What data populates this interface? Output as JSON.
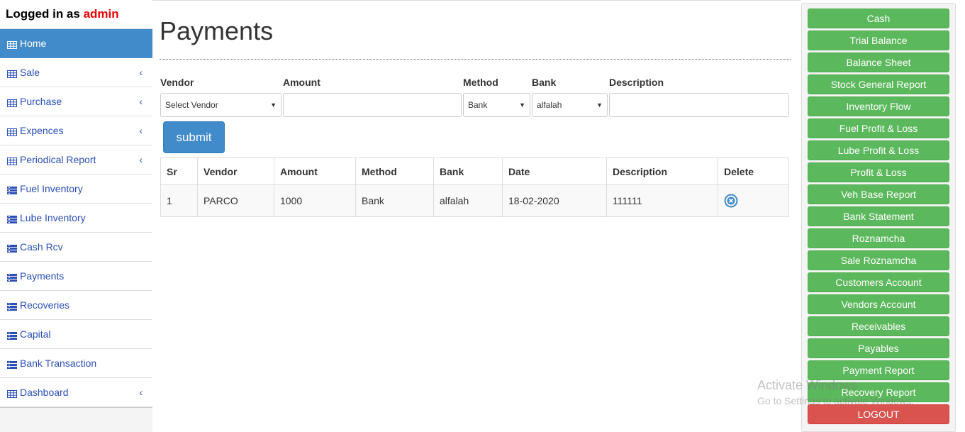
{
  "user": {
    "prefix": "Logged in as ",
    "name": "admin"
  },
  "sidebar": {
    "items": [
      {
        "label": "Home",
        "icon": "table-icon",
        "chevron": false,
        "active": true
      },
      {
        "label": "Sale",
        "icon": "table-icon",
        "chevron": true
      },
      {
        "label": "Purchase",
        "icon": "table-icon",
        "chevron": true
      },
      {
        "label": "Expences",
        "icon": "table-icon",
        "chevron": true
      },
      {
        "label": "Periodical Report",
        "icon": "table-icon",
        "chevron": true
      },
      {
        "label": "Fuel Inventory",
        "icon": "list-icon",
        "chevron": false
      },
      {
        "label": "Lube Inventory",
        "icon": "list-icon",
        "chevron": false
      },
      {
        "label": "Cash Rcv",
        "icon": "list-icon",
        "chevron": false
      },
      {
        "label": "Payments",
        "icon": "list-icon",
        "chevron": false
      },
      {
        "label": "Recoveries",
        "icon": "list-icon",
        "chevron": false
      },
      {
        "label": "Capital",
        "icon": "list-icon",
        "chevron": false
      },
      {
        "label": "Bank Transaction",
        "icon": "list-icon",
        "chevron": false
      },
      {
        "label": "Dashboard",
        "icon": "table-icon",
        "chevron": true
      }
    ],
    "chevron_glyph": "‹"
  },
  "main": {
    "title": "Payments",
    "form": {
      "vendor_label": "Vendor",
      "vendor_value": "Select Vendor",
      "amount_label": "Amount",
      "amount_value": "",
      "method_label": "Method",
      "method_value": "Bank",
      "bank_label": "Bank",
      "bank_value": "alfalah",
      "description_label": "Description",
      "description_value": "",
      "submit_label": "submit"
    },
    "table": {
      "headers": [
        "Sr",
        "Vendor",
        "Amount",
        "Method",
        "Bank",
        "Date",
        "Description",
        "Delete"
      ],
      "rows": [
        [
          "1",
          "PARCO",
          "1000",
          "Bank",
          "alfalah",
          "18-02-2020",
          "111111"
        ]
      ]
    }
  },
  "right_panel": {
    "buttons": [
      "Cash",
      "Trial Balance",
      "Balance Sheet",
      "Stock General Report",
      "Inventory Flow",
      "Fuel Profit & Loss",
      "Lube Profit & Loss",
      "Profit & Loss",
      "Veh Base Report",
      "Bank Statement",
      "Roznamcha",
      "Sale Roznamcha",
      "Customers Account",
      "Vendors Account",
      "Receivables",
      "Payables",
      "Payment Report",
      "Recovery Report"
    ],
    "logout_label": "LOGOUT"
  },
  "watermark": {
    "line1": "Activate Windows",
    "line2": "Go to Settings to activate Windows."
  },
  "colors": {
    "primary": "#428bca",
    "success": "#5cb85c",
    "danger": "#d9534f",
    "admin": "#e00000"
  }
}
